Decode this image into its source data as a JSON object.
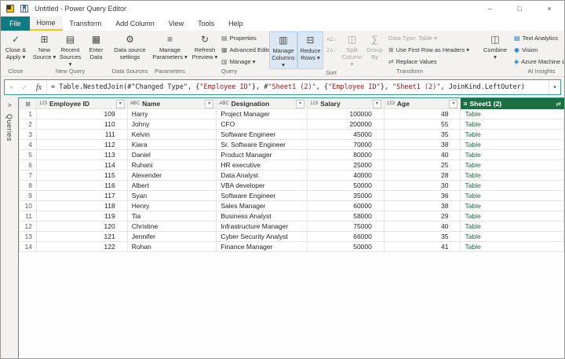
{
  "colors": {
    "file-teal": "#0f7b83",
    "accent-yellow": "#f2c80f",
    "green": "#1d6f42",
    "string-red": "#a31515",
    "focus": "#3a9b8e",
    "hl-bg": "#dbe7f3",
    "hl-border": "#b9cfe4",
    "ai-blue": "#0078d4"
  },
  "titlebar": {
    "title": "Untitled - Power Query Editor",
    "minimize": "–",
    "maximize": "□",
    "close": "×"
  },
  "tabs": {
    "file": "File",
    "home": "Home",
    "transform": "Transform",
    "add_column": "Add Column",
    "view": "View",
    "tools": "Tools",
    "help": "Help"
  },
  "ribbon": {
    "close": {
      "group": "Close",
      "apply_label": "Close &\nApply ▾",
      "apply_icon": "✓"
    },
    "new_query": {
      "group": "New Query",
      "new_source": "New\nSource ▾",
      "new_source_icon": "⊞",
      "recent_sources": "Recent\nSources ▾",
      "recent_sources_icon": "▤",
      "enter_data": "Enter\nData",
      "enter_data_icon": "▦"
    },
    "data_sources": {
      "group": "Data Sources",
      "settings": "Data source\nsettings",
      "settings_icon": "⚙"
    },
    "parameters": {
      "group": "Parameters",
      "manage": "Manage\nParameters ▾",
      "manage_icon": "≡"
    },
    "query": {
      "group": "Query",
      "refresh": "Refresh\nPreview ▾",
      "refresh_icon": "↻",
      "properties": "Properties",
      "properties_icon": "▤",
      "advanced_editor": "Advanced Editor",
      "advanced_editor_icon": "▦",
      "manage": "Manage ▾",
      "manage_icon": "▥"
    },
    "columns_rows": {
      "manage_columns": "Manage\nColumns ▾",
      "manage_columns_icon": "▥",
      "reduce_rows": "Reduce\nRows ▾",
      "reduce_rows_icon": "⊟",
      "sort_group": "Sort",
      "sort_az": "AZ↓",
      "sort_za": "ZA↓"
    },
    "transform": {
      "group": "Transform",
      "split_column": "Split\nColumn ▾",
      "split_column_icon": "◫",
      "group_by": "Group\nBy",
      "group_by_icon": "∑",
      "data_type": "Data Type: Table ▾",
      "first_row_headers": "Use First Row as Headers ▾",
      "first_row_headers_icon": "⊞",
      "replace_values": "Replace Values",
      "replace_values_icon": "⇄"
    },
    "combine": {
      "group": "",
      "label": "Combine\n▾",
      "icon": "◫"
    },
    "ai": {
      "group": "AI Insights",
      "text_analytics": "Text Analytics",
      "text_analytics_icon": "▤",
      "vision": "Vision",
      "vision_icon": "◉",
      "azure_ml": "Azure Machine Lea",
      "azure_ml_icon": "◈"
    }
  },
  "formula_bar": {
    "cancel_icon": "×",
    "check_icon": "✓",
    "fx": "fx",
    "dropdown_icon": "▾",
    "segments": [
      {
        "t": "= Table.NestedJoin(#\"Changed Type\", {",
        "c": "code"
      },
      {
        "t": "\"Employee ID\"",
        "c": "string"
      },
      {
        "t": "}, #",
        "c": "code"
      },
      {
        "t": "\"Sheet1 (2)\"",
        "c": "string"
      },
      {
        "t": ", {",
        "c": "code"
      },
      {
        "t": "\"Employee ID\"",
        "c": "string"
      },
      {
        "t": "}, ",
        "c": "code"
      },
      {
        "t": "\"Sheet1 (2)\"",
        "c": "string"
      },
      {
        "t": ", JoinKind.LeftOuter)",
        "c": "code"
      }
    ]
  },
  "queries_pane": {
    "expand_icon": ">",
    "label": "Queries"
  },
  "table": {
    "corner_icon": "⊞",
    "filter_icon": "▾",
    "expand_icon": "⇄",
    "columns": [
      {
        "name": "Employee ID",
        "type_icon": "123",
        "align": "right"
      },
      {
        "name": "Name",
        "type_icon": "ABC",
        "align": "left"
      },
      {
        "name": "Designation",
        "type_icon": "ABC",
        "align": "left"
      },
      {
        "name": "Salary",
        "type_icon": "123",
        "align": "right"
      },
      {
        "name": "Age",
        "type_icon": "123",
        "align": "right"
      },
      {
        "name": "Sheet1 (2)",
        "type_icon": "⊞",
        "align": "left",
        "highlight": true,
        "link": true
      }
    ],
    "rows": [
      [
        "1",
        "109",
        "Harry",
        "Project Manager",
        "100000",
        "48",
        "Table"
      ],
      [
        "2",
        "110",
        "Johny",
        "CFO",
        "200000",
        "55",
        "Table"
      ],
      [
        "3",
        "111",
        "Kelvin",
        "Software Engineer",
        "45000",
        "35",
        "Table"
      ],
      [
        "4",
        "112",
        "Kiara",
        "Sr. Software Engineer",
        "70000",
        "38",
        "Table"
      ],
      [
        "5",
        "113",
        "Daniel",
        "Product Manager",
        "80000",
        "40",
        "Table"
      ],
      [
        "6",
        "114",
        "Ruhani",
        "HR executive",
        "25000",
        "25",
        "Table"
      ],
      [
        "7",
        "115",
        "Alexender",
        "Data Analyst",
        "40000",
        "28",
        "Table"
      ],
      [
        "8",
        "116",
        "Albert",
        "VBA developer",
        "50000",
        "30",
        "Table"
      ],
      [
        "9",
        "117",
        "Syan",
        "Software Engineer",
        "35000",
        "36",
        "Table"
      ],
      [
        "10",
        "118",
        "Henry",
        "Sales Manager",
        "60000",
        "38",
        "Table"
      ],
      [
        "11",
        "119",
        "Tia",
        "Business Analyst",
        "58000",
        "29",
        "Table"
      ],
      [
        "12",
        "120",
        "Christine",
        "Infrastructure Manager",
        "75000",
        "40",
        "Table"
      ],
      [
        "13",
        "121",
        "Jennifer",
        "Cyber Security Analyst",
        "66000",
        "35",
        "Table"
      ],
      [
        "14",
        "122",
        "Rohan",
        "Finance Manager",
        "50000",
        "41",
        "Table"
      ]
    ]
  }
}
